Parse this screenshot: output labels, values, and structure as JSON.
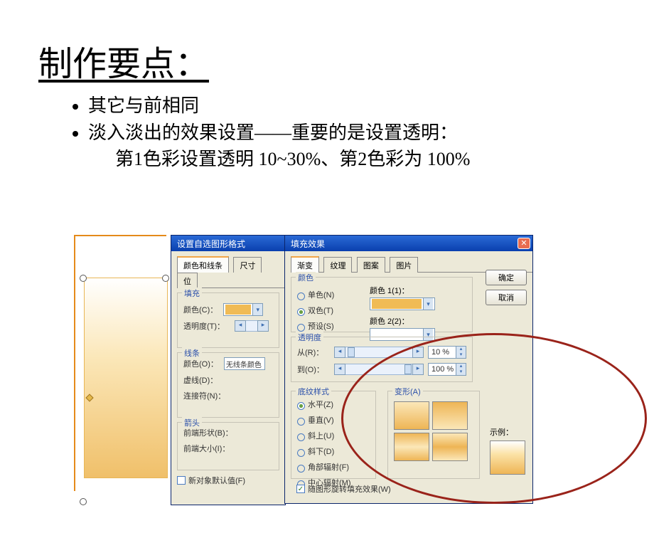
{
  "slide": {
    "title": "制作要点：",
    "bullets": {
      "b1": "其它与前相同",
      "b2": "淡入淡出的效果设置——重要的是设置透明：",
      "b2_sub": "第1色彩设置透明 10~30%、第2色彩为 100%"
    }
  },
  "format_dialog": {
    "title": "设置自选图形格式",
    "tabs": {
      "t1": "颜色和线条",
      "t2": "尺寸",
      "t3": "位"
    },
    "groups": {
      "fill": "填充",
      "line": "线条",
      "arrow": "箭头"
    },
    "labels": {
      "color": "颜色(C)：",
      "transparency": "透明度(T)：",
      "line_color": "颜色(O)：",
      "line_color_val": "无线条颜色",
      "dash": "虚线(D)：",
      "connector": "连接符(N)：",
      "begin_shape": "前端形状(B)：",
      "begin_size": "前端大小(I)：",
      "default_new": "新对象默认值(F)"
    },
    "colors": {
      "selected": "#f0bb55"
    }
  },
  "fill_dialog": {
    "title": "填充效果",
    "tabs": {
      "t1": "渐变",
      "t2": "纹理",
      "t3": "图案",
      "t4": "图片"
    },
    "buttons": {
      "ok": "确定",
      "cancel": "取消"
    },
    "groups": {
      "color": "颜色",
      "transparency": "透明度",
      "shading": "底纹样式",
      "variants": "变形(A)"
    },
    "color_opts": {
      "one": "单色(N)",
      "two": "双色(T)",
      "preset": "预设(S)"
    },
    "color_labels": {
      "c1": "颜色 1(1)：",
      "c2": "颜色 2(2)："
    },
    "trans": {
      "from": "从(R)：",
      "from_val": "10 %",
      "to": "到(O)：",
      "to_val": "100 %"
    },
    "shading_opts": {
      "horizontal": "水平(Z)",
      "vertical": "垂直(V)",
      "diag_up": "斜上(U)",
      "diag_down": "斜下(D)",
      "corner": "角部辐射(F)",
      "center": "中心辐射(M)"
    },
    "sample_label": "示例：",
    "rotate_with_shape": "随图形旋转填充效果(W)",
    "swatches": {
      "c1": "#f0bb55"
    }
  }
}
